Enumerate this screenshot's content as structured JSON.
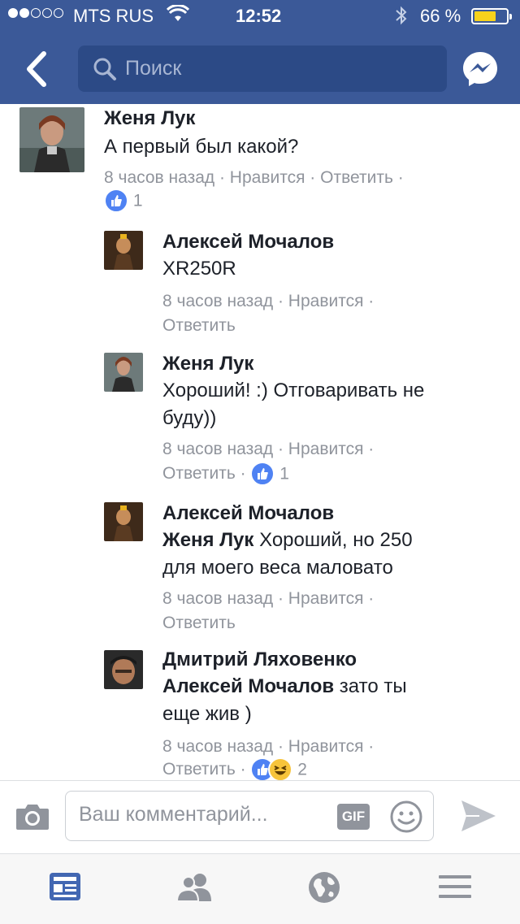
{
  "status_bar": {
    "carrier": "MTS RUS",
    "time": "12:52",
    "battery_percent": "66 %",
    "signal_bars_filled": 2,
    "signal_bars_total": 5
  },
  "header": {
    "back_icon": "chevron-left-icon",
    "search_placeholder": "Поиск",
    "messenger_icon": "messenger-icon"
  },
  "comments": [
    {
      "name": "Женя Лук",
      "text": "А первый был какой?",
      "meta": "8 часов назад · Нравится · Ответить ·",
      "reaction_count": "1",
      "reactions": [
        "like"
      ]
    },
    {
      "name": "Алексей Мочалов",
      "text": "XR250R",
      "meta_line1": "8 часов назад · Нравится ·",
      "meta_line2": "Ответить"
    },
    {
      "name": "Женя Лук",
      "text_line1": "Хороший! :) Отговаривать не",
      "text_line2": "буду))",
      "meta_line1": "8 часов назад · Нравится ·",
      "meta_line2": "Ответить ·",
      "reaction_count": "1",
      "reactions": [
        "like"
      ]
    },
    {
      "name": "Алексей Мочалов",
      "mention": "Женя Лук",
      "text_line1": " Хороший, но 250",
      "text_line2": "для моего веса маловато",
      "meta_line1": "8 часов назад · Нравится ·",
      "meta_line2": "Ответить"
    },
    {
      "name": "Дмитрий Ляховенко",
      "mention": "Алексей Мочалов",
      "text_line1": " зато ты",
      "text_line2": "еще жив )",
      "meta_line1": "8 часов назад · Нравится ·",
      "meta_line2": "Ответить ·",
      "reaction_count": "2",
      "reactions": [
        "like",
        "haha"
      ]
    }
  ],
  "composer": {
    "placeholder": "Ваш комментарий...",
    "gif_label": "GIF"
  },
  "tabbar": {
    "tabs": [
      "news-feed-icon",
      "friends-icon",
      "globe-icon",
      "menu-icon"
    ]
  },
  "colors": {
    "brand": "#3b5998",
    "like_blue": "#4f82f3",
    "meta_gray": "#90949c"
  }
}
